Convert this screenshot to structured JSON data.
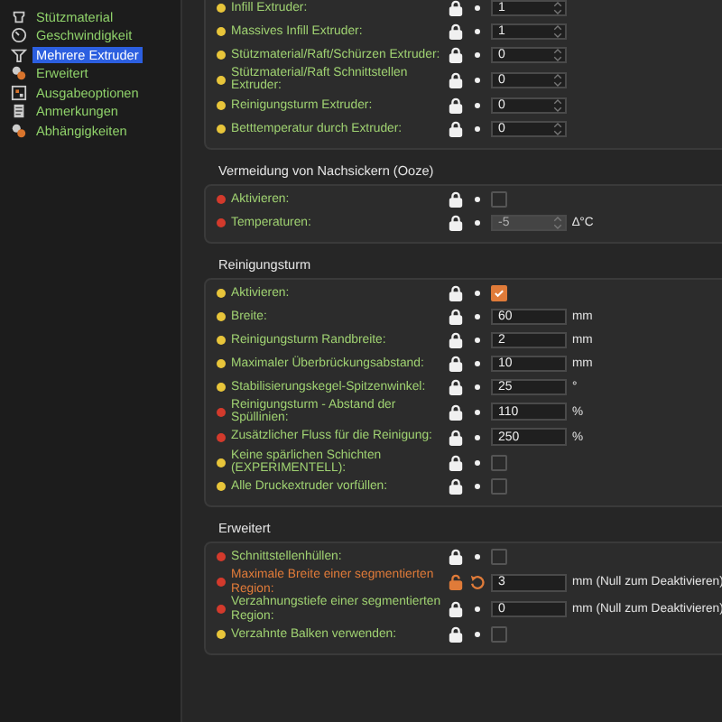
{
  "sidebar": {
    "items": [
      {
        "label": "Stützmaterial",
        "selected": false
      },
      {
        "label": "Geschwindigkeit",
        "selected": false
      },
      {
        "label": "Mehrere Extruder",
        "selected": true
      },
      {
        "label": "Erweitert",
        "selected": false
      },
      {
        "label": "Ausgabeoptionen",
        "selected": false
      },
      {
        "label": "Anmerkungen",
        "selected": false
      },
      {
        "label": "Abhängigkeiten",
        "selected": false
      }
    ]
  },
  "groups": [
    {
      "rows": [
        {
          "label": "Infill Extruder:",
          "color": "#e8c53a",
          "kind": "spin",
          "value": "1",
          "locked": true,
          "modified": false
        },
        {
          "label": "Massives Infill Extruder:",
          "color": "#e8c53a",
          "kind": "spin",
          "value": "1",
          "locked": true,
          "modified": false
        },
        {
          "label": "Stützmaterial/Raft/Schürzen Extruder:",
          "color": "#e8c53a",
          "kind": "spin",
          "value": "0",
          "locked": true,
          "modified": false
        },
        {
          "label": "Stützmaterial/Raft Schnittstellen Extruder:",
          "color": "#e8c53a",
          "kind": "spin",
          "value": "0",
          "locked": true,
          "modified": false
        },
        {
          "label": "Reinigungsturm Extruder:",
          "color": "#e8c53a",
          "kind": "spin",
          "value": "0",
          "locked": true,
          "modified": false
        },
        {
          "label": "Betttemperatur durch Extruder:",
          "color": "#e8c53a",
          "kind": "spin",
          "value": "0",
          "locked": true,
          "modified": false
        }
      ]
    },
    {
      "title": "Vermeidung von Nachsickern (Ooze)",
      "rows": [
        {
          "label": "Aktivieren:",
          "color": "#d33a2c",
          "kind": "checkbox",
          "checked": false,
          "locked": true,
          "modified": false
        },
        {
          "label": "Temperaturen:",
          "color": "#d33a2c",
          "kind": "spin",
          "value": "-5",
          "unit": "∆°C",
          "disabled": true,
          "locked": true,
          "modified": false
        }
      ]
    },
    {
      "title": "Reinigungsturm",
      "rows": [
        {
          "label": "Aktivieren:",
          "color": "#e8c53a",
          "kind": "checkbox",
          "checked": true,
          "locked": true,
          "modified": false
        },
        {
          "label": "Breite:",
          "color": "#e8c53a",
          "kind": "text",
          "value": "60",
          "unit": "mm",
          "locked": true,
          "modified": false
        },
        {
          "label": "Reinigungsturm Randbreite:",
          "color": "#e8c53a",
          "kind": "text",
          "value": "2",
          "unit": "mm",
          "locked": true,
          "modified": false
        },
        {
          "label": "Maximaler Überbrückungsabstand:",
          "color": "#e8c53a",
          "kind": "text",
          "value": "10",
          "unit": "mm",
          "locked": true,
          "modified": false
        },
        {
          "label": "Stabilisierungskegel-Spitzenwinkel:",
          "color": "#e8c53a",
          "kind": "text",
          "value": "25",
          "unit": "°",
          "locked": true,
          "modified": false
        },
        {
          "label": "Reinigungsturm - Abstand der Spüllinien:",
          "color": "#d33a2c",
          "kind": "text",
          "value": "110",
          "unit": "%",
          "locked": true,
          "modified": false
        },
        {
          "label": "Zusätzlicher Fluss für die Reinigung:",
          "color": "#d33a2c",
          "kind": "text",
          "value": "250",
          "unit": "%",
          "locked": true,
          "modified": false
        },
        {
          "label": "Keine spärlichen Schichten (EXPERIMENTELL):",
          "color": "#e8c53a",
          "kind": "checkbox",
          "checked": false,
          "locked": true,
          "modified": false
        },
        {
          "label": "Alle Druckextruder vorfüllen:",
          "color": "#e8c53a",
          "kind": "checkbox",
          "checked": false,
          "locked": true,
          "modified": false
        }
      ]
    },
    {
      "title": "Erweitert",
      "rows": [
        {
          "label": "Schnittstellenhüllen:",
          "color": "#d33a2c",
          "kind": "checkbox",
          "checked": false,
          "locked": true,
          "modified": false
        },
        {
          "label": "Maximale Breite einer segmentierten Region:",
          "color": "#d33a2c",
          "kind": "text",
          "value": "3",
          "unit": "mm (Null zum Deaktivieren)",
          "locked": false,
          "modified": true
        },
        {
          "label": "Verzahnungstiefe einer segmentierten Region:",
          "color": "#d33a2c",
          "kind": "text",
          "value": "0",
          "unit": "mm (Null zum Deaktivieren)",
          "locked": true,
          "modified": false
        },
        {
          "label": "Verzahnte Balken verwenden:",
          "color": "#e8c53a",
          "kind": "checkbox",
          "checked": false,
          "locked": true,
          "modified": false
        }
      ]
    }
  ]
}
